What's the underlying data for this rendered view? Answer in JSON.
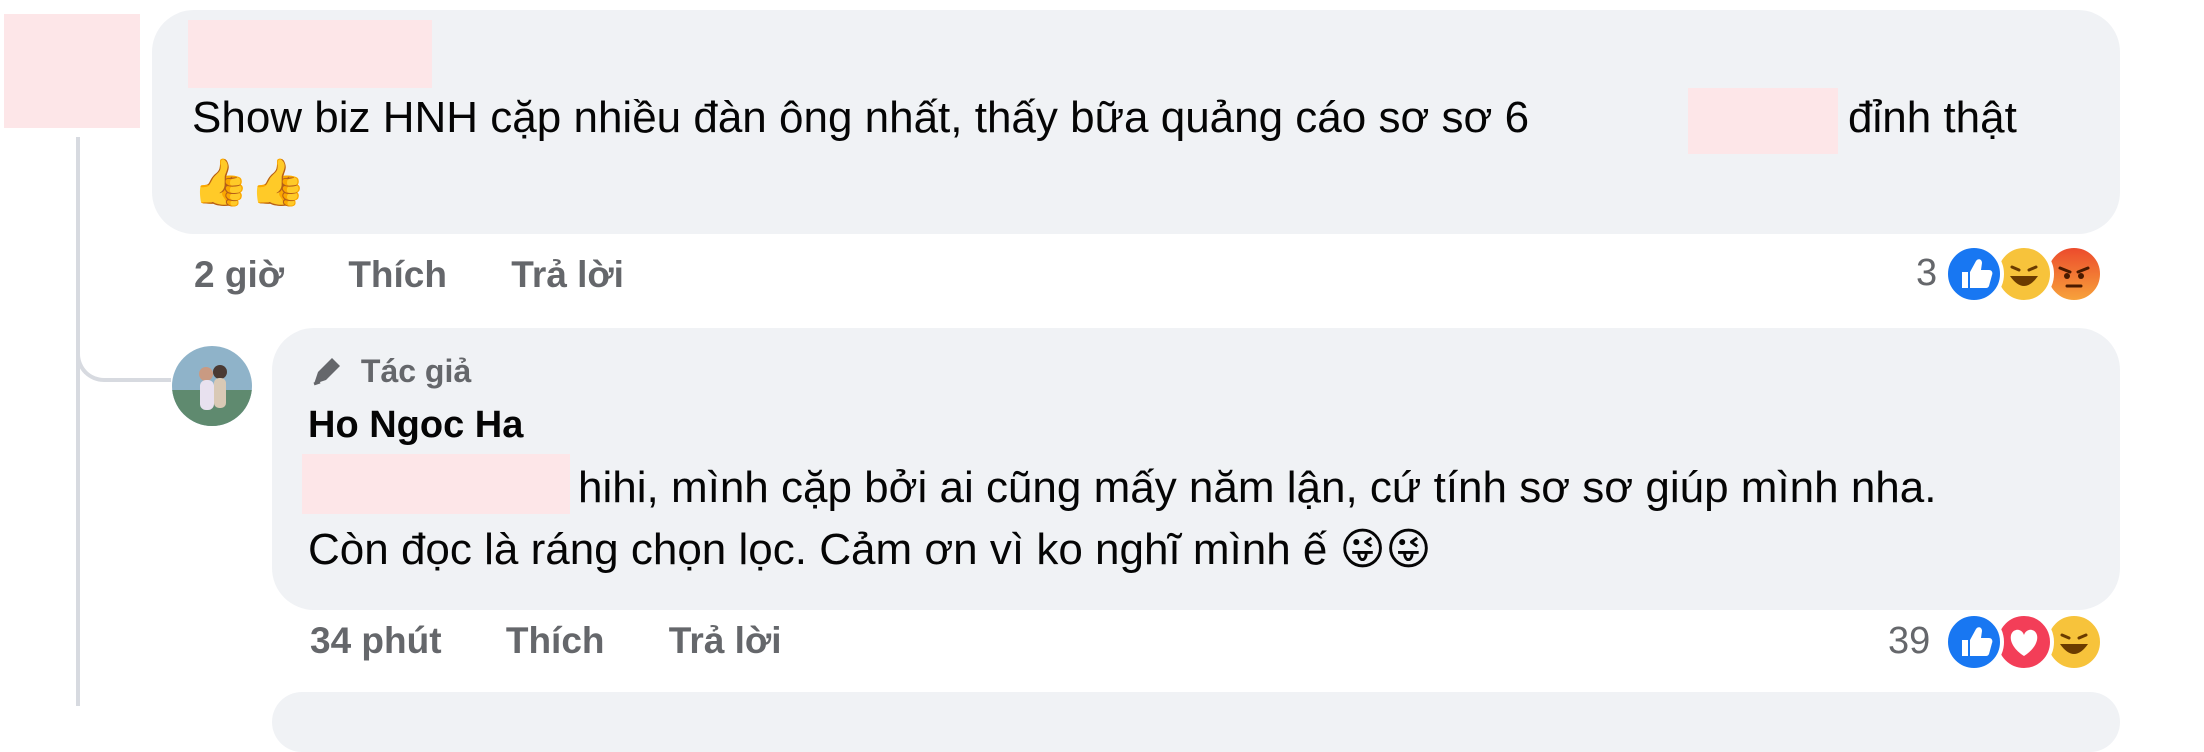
{
  "comment1": {
    "text_before": "Show biz HNH cặp nhiều đàn ông nhất, thấy bữa quảng cáo sơ sơ 6",
    "text_after": "đỉnh thật",
    "emoji": "👍👍",
    "time": "2 giờ",
    "like_label": "Thích",
    "reply_label": "Trả lời",
    "reaction_count": "3",
    "reactions": [
      "like-icon",
      "haha-icon",
      "angry-icon"
    ]
  },
  "reply1": {
    "badge": "Tác giả",
    "author": "Ho Ngoc Ha",
    "line1": "hihi, mình cặp bởi ai cũng mấy năm lận, cứ tính sơ sơ giúp mình nha.",
    "line2": "Còn đọc là ráng chọn lọc. Cảm ơn vì ko nghĩ mình ế",
    "emoji": "😜😜",
    "time": "34 phút",
    "like_label": "Thích",
    "reply_label": "Trả lời",
    "reaction_count": "39",
    "reactions": [
      "like-icon",
      "love-icon",
      "haha-icon"
    ]
  },
  "colors": {
    "bubble": "#f0f2f5",
    "like_blue": "#1877f2",
    "love_red": "#f33e58",
    "meta_gray": "#65676b",
    "redaction": "#fde6e8"
  }
}
